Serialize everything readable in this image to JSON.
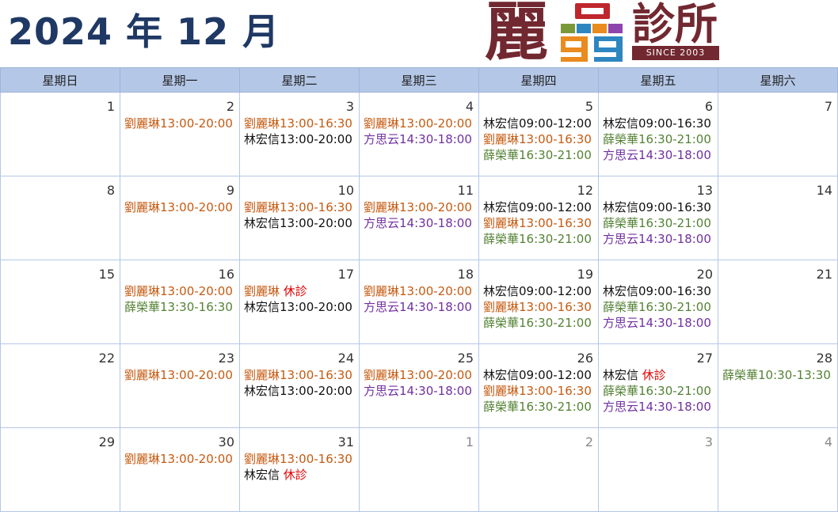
{
  "header": {
    "title": "2024 年 12 月",
    "logo": {
      "char_li": "麗",
      "name": "診所",
      "since": "SINCE 2003"
    }
  },
  "colors": {
    "orange": "#c55a11",
    "black": "#111111",
    "purple": "#7030a0",
    "green": "#548235",
    "red": "#e00000",
    "header_bg": "#b4c7e7",
    "title": "#1f3864"
  },
  "weekdays": [
    "星期日",
    "星期一",
    "星期二",
    "星期三",
    "星期四",
    "星期五",
    "星期六"
  ],
  "weeks": [
    [
      {
        "day": "1",
        "shifts": []
      },
      {
        "day": "2",
        "shifts": [
          {
            "name": "劉麗琳",
            "time": "13:00-20:00",
            "color": "orange"
          }
        ]
      },
      {
        "day": "3",
        "shifts": [
          {
            "name": "劉麗琳",
            "time": "13:00-16:30",
            "color": "orange"
          },
          {
            "name": "林宏信",
            "time": "13:00-20:00",
            "color": "black"
          }
        ]
      },
      {
        "day": "4",
        "shifts": [
          {
            "name": "劉麗琳",
            "time": "13:00-20:00",
            "color": "orange"
          },
          {
            "name": "方思云",
            "time": "14:30-18:00",
            "color": "purple"
          }
        ]
      },
      {
        "day": "5",
        "shifts": [
          {
            "name": "林宏信",
            "time": "09:00-12:00",
            "color": "black"
          },
          {
            "name": "劉麗琳",
            "time": "13:00-16:30",
            "color": "orange"
          },
          {
            "name": "薛榮華",
            "time": "16:30-21:00",
            "color": "green"
          }
        ]
      },
      {
        "day": "6",
        "shifts": [
          {
            "name": "林宏信",
            "time": "09:00-16:30",
            "color": "black"
          },
          {
            "name": "薛榮華",
            "time": "16:30-21:00",
            "color": "green"
          },
          {
            "name": "方思云",
            "time": "14:30-18:00",
            "color": "purple"
          }
        ]
      },
      {
        "day": "7",
        "shifts": []
      }
    ],
    [
      {
        "day": "8",
        "shifts": []
      },
      {
        "day": "9",
        "shifts": [
          {
            "name": "劉麗琳",
            "time": "13:00-20:00",
            "color": "orange"
          }
        ]
      },
      {
        "day": "10",
        "shifts": [
          {
            "name": "劉麗琳",
            "time": "13:00-16:30",
            "color": "orange"
          },
          {
            "name": "林宏信",
            "time": "13:00-20:00",
            "color": "black"
          }
        ]
      },
      {
        "day": "11",
        "shifts": [
          {
            "name": "劉麗琳",
            "time": "13:00-20:00",
            "color": "orange"
          },
          {
            "name": "方思云",
            "time": "14:30-18:00",
            "color": "purple"
          }
        ]
      },
      {
        "day": "12",
        "shifts": [
          {
            "name": "林宏信",
            "time": "09:00-12:00",
            "color": "black"
          },
          {
            "name": "劉麗琳",
            "time": "13:00-16:30",
            "color": "orange"
          },
          {
            "name": "薛榮華",
            "time": "16:30-21:00",
            "color": "green"
          }
        ]
      },
      {
        "day": "13",
        "shifts": [
          {
            "name": "林宏信",
            "time": "09:00-16:30",
            "color": "black"
          },
          {
            "name": "薛榮華",
            "time": "16:30-21:00",
            "color": "green"
          },
          {
            "name": "方思云",
            "time": "14:30-18:00",
            "color": "purple"
          }
        ]
      },
      {
        "day": "14",
        "shifts": []
      }
    ],
    [
      {
        "day": "15",
        "shifts": []
      },
      {
        "day": "16",
        "shifts": [
          {
            "name": "劉麗琳",
            "time": "13:00-20:00",
            "color": "orange"
          },
          {
            "name": "薛榮華",
            "time": "13:30-16:30",
            "color": "green"
          }
        ]
      },
      {
        "day": "17",
        "shifts": [
          {
            "name": "劉麗琳",
            "time": "休診",
            "color": "orange",
            "closed": true
          },
          {
            "name": "林宏信",
            "time": "13:00-20:00",
            "color": "black"
          }
        ]
      },
      {
        "day": "18",
        "shifts": [
          {
            "name": "劉麗琳",
            "time": "13:00-20:00",
            "color": "orange"
          },
          {
            "name": "方思云",
            "time": "14:30-18:00",
            "color": "purple"
          }
        ]
      },
      {
        "day": "19",
        "shifts": [
          {
            "name": "林宏信",
            "time": "09:00-12:00",
            "color": "black"
          },
          {
            "name": "劉麗琳",
            "time": "13:00-16:30",
            "color": "orange"
          },
          {
            "name": "薛榮華",
            "time": "16:30-21:00",
            "color": "green"
          }
        ]
      },
      {
        "day": "20",
        "shifts": [
          {
            "name": "林宏信",
            "time": "09:00-16:30",
            "color": "black"
          },
          {
            "name": "薛榮華",
            "time": "16:30-21:00",
            "color": "green"
          },
          {
            "name": "方思云",
            "time": "14:30-18:00",
            "color": "purple"
          }
        ]
      },
      {
        "day": "21",
        "shifts": []
      }
    ],
    [
      {
        "day": "22",
        "shifts": []
      },
      {
        "day": "23",
        "shifts": [
          {
            "name": "劉麗琳",
            "time": "13:00-20:00",
            "color": "orange"
          }
        ]
      },
      {
        "day": "24",
        "shifts": [
          {
            "name": "劉麗琳",
            "time": "13:00-16:30",
            "color": "orange"
          },
          {
            "name": "林宏信",
            "time": "13:00-20:00",
            "color": "black"
          }
        ]
      },
      {
        "day": "25",
        "shifts": [
          {
            "name": "劉麗琳",
            "time": "13:00-20:00",
            "color": "orange"
          },
          {
            "name": "方思云",
            "time": "14:30-18:00",
            "color": "purple"
          }
        ]
      },
      {
        "day": "26",
        "shifts": [
          {
            "name": "林宏信",
            "time": "09:00-12:00",
            "color": "black"
          },
          {
            "name": "劉麗琳",
            "time": "13:00-16:30",
            "color": "orange"
          },
          {
            "name": "薛榮華",
            "time": "16:30-21:00",
            "color": "green"
          }
        ]
      },
      {
        "day": "27",
        "shifts": [
          {
            "name": "林宏信",
            "time": "休診",
            "color": "black",
            "closed": true
          },
          {
            "name": "薛榮華",
            "time": "16:30-21:00",
            "color": "green"
          },
          {
            "name": "方思云",
            "time": "14:30-18:00",
            "color": "purple"
          }
        ]
      },
      {
        "day": "28",
        "shifts": [
          {
            "name": "薛榮華",
            "time": "10:30-13:30",
            "color": "green"
          }
        ]
      }
    ],
    [
      {
        "day": "29",
        "shifts": []
      },
      {
        "day": "30",
        "shifts": [
          {
            "name": "劉麗琳",
            "time": "13:00-20:00",
            "color": "orange"
          }
        ]
      },
      {
        "day": "31",
        "shifts": [
          {
            "name": "劉麗琳",
            "time": "13:00-16:30",
            "color": "orange"
          },
          {
            "name": "林宏信",
            "time": "休診",
            "color": "black",
            "closed": true
          }
        ]
      },
      {
        "day": "1",
        "out": true,
        "shifts": []
      },
      {
        "day": "2",
        "out": true,
        "shifts": []
      },
      {
        "day": "3",
        "out": true,
        "shifts": []
      },
      {
        "day": "4",
        "out": true,
        "shifts": []
      }
    ]
  ]
}
